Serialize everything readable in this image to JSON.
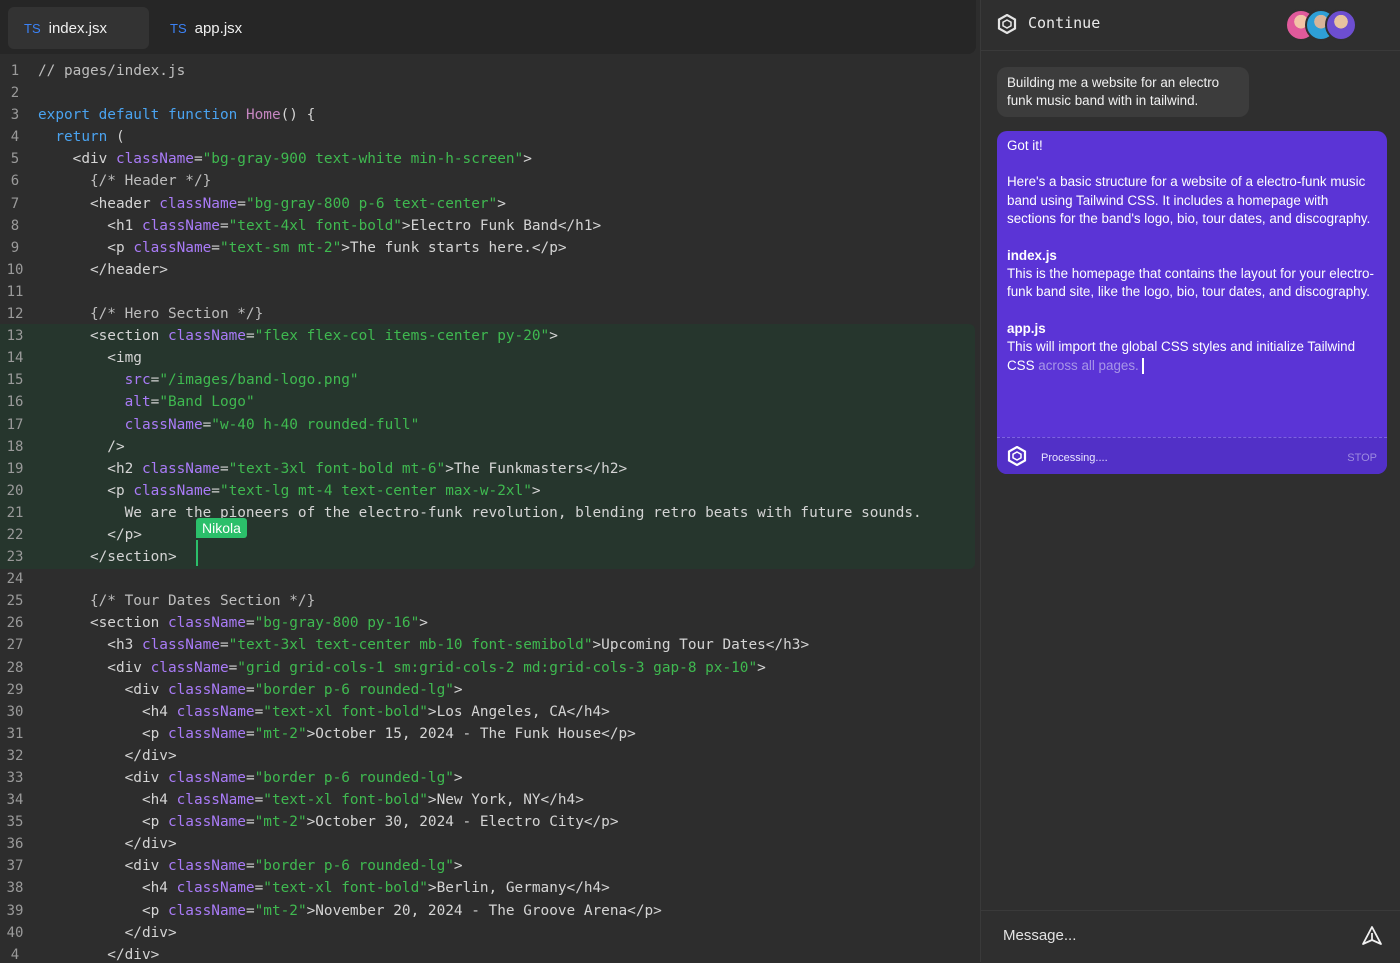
{
  "tabs": [
    {
      "badge": "TS",
      "label": "index.jsx",
      "active": true
    },
    {
      "badge": "TS",
      "label": "app.jsx",
      "active": false
    }
  ],
  "code_lines": [
    {
      "n": "1",
      "html": "<span class=\"c\">// pages/index.js</span>"
    },
    {
      "n": "2",
      "html": ""
    },
    {
      "n": "3",
      "html": "<span class=\"k\">export default function</span> <span class=\"fn\">Home</span>() {"
    },
    {
      "n": "4",
      "html": "  <span class=\"k\">return</span> ("
    },
    {
      "n": "5",
      "html": "    &lt;div <span class=\"a\">className</span>=<span class=\"s\">\"bg-gray-900 text-white min-h-screen\"</span>&gt;"
    },
    {
      "n": "6",
      "html": "      <span class=\"c\">{/* Header */}</span>"
    },
    {
      "n": "7",
      "html": "      &lt;header <span class=\"a\">className</span>=<span class=\"s\">\"bg-gray-800 p-6 text-center\"</span>&gt;"
    },
    {
      "n": "8",
      "html": "        &lt;h1 <span class=\"a\">className</span>=<span class=\"s\">\"text-4xl font-bold\"</span>&gt;Electro Funk Band&lt;/h1&gt;"
    },
    {
      "n": "9",
      "html": "        &lt;p <span class=\"a\">className</span>=<span class=\"s\">\"text-sm mt-2\"</span>&gt;The funk starts here.&lt;/p&gt;"
    },
    {
      "n": "10",
      "html": "      &lt;/header&gt;"
    },
    {
      "n": "11",
      "html": ""
    },
    {
      "n": "12",
      "html": "      <span class=\"c\">{/* Hero Section */}</span>"
    },
    {
      "n": "13",
      "html": "      &lt;section <span class=\"a\">className</span>=<span class=\"s\">\"flex flex-col items-center py-20\"</span>&gt;"
    },
    {
      "n": "14",
      "html": "        &lt;img"
    },
    {
      "n": "15",
      "html": "          <span class=\"a\">src</span>=<span class=\"s\">\"/images/band-logo.png\"</span>"
    },
    {
      "n": "16",
      "html": "          <span class=\"a\">alt</span>=<span class=\"s\">\"Band Logo\"</span>"
    },
    {
      "n": "17",
      "html": "          <span class=\"a\">className</span>=<span class=\"s\">\"w-40 h-40 rounded-full\"</span>"
    },
    {
      "n": "18",
      "html": "        /&gt;"
    },
    {
      "n": "19",
      "html": "        &lt;h2 <span class=\"a\">className</span>=<span class=\"s\">\"text-3xl font-bold mt-6\"</span>&gt;The Funkmasters&lt;/h2&gt;"
    },
    {
      "n": "20",
      "html": "        &lt;p <span class=\"a\">className</span>=<span class=\"s\">\"text-lg mt-4 text-center max-w-2xl\"</span>&gt;"
    },
    {
      "n": "21",
      "html": "          We are the pioneers of the electro-funk revolution, blending retro beats with future sounds."
    },
    {
      "n": "22",
      "html": "        &lt;/p&gt;"
    },
    {
      "n": "23",
      "html": "      &lt;/section&gt;"
    },
    {
      "n": "24",
      "html": ""
    },
    {
      "n": "25",
      "html": "      <span class=\"c\">{/* Tour Dates Section */}</span>"
    },
    {
      "n": "26",
      "html": "      &lt;section <span class=\"a\">className</span>=<span class=\"s\">\"bg-gray-800 py-16\"</span>&gt;"
    },
    {
      "n": "27",
      "html": "        &lt;h3 <span class=\"a\">className</span>=<span class=\"s\">\"text-3xl text-center mb-10 font-semibold\"</span>&gt;Upcoming Tour Dates&lt;/h3&gt;"
    },
    {
      "n": "28",
      "html": "        &lt;div <span class=\"a\">className</span>=<span class=\"s\">\"grid grid-cols-1 sm:grid-cols-2 md:grid-cols-3 gap-8 px-10\"</span>&gt;"
    },
    {
      "n": "29",
      "html": "          &lt;div <span class=\"a\">className</span>=<span class=\"s\">\"border p-6 rounded-lg\"</span>&gt;"
    },
    {
      "n": "30",
      "html": "            &lt;h4 <span class=\"a\">className</span>=<span class=\"s\">\"text-xl font-bold\"</span>&gt;Los Angeles, CA&lt;/h4&gt;"
    },
    {
      "n": "31",
      "html": "            &lt;p <span class=\"a\">className</span>=<span class=\"s\">\"mt-2\"</span>&gt;October 15, 2024 - The Funk House&lt;/p&gt;"
    },
    {
      "n": "32",
      "html": "          &lt;/div&gt;"
    },
    {
      "n": "33",
      "html": "          &lt;div <span class=\"a\">className</span>=<span class=\"s\">\"border p-6 rounded-lg\"</span>&gt;"
    },
    {
      "n": "34",
      "html": "            &lt;h4 <span class=\"a\">className</span>=<span class=\"s\">\"text-xl font-bold\"</span>&gt;New York, NY&lt;/h4&gt;"
    },
    {
      "n": "35",
      "html": "            &lt;p <span class=\"a\">className</span>=<span class=\"s\">\"mt-2\"</span>&gt;October 30, 2024 - Electro City&lt;/p&gt;"
    },
    {
      "n": "36",
      "html": "          &lt;/div&gt;"
    },
    {
      "n": "37",
      "html": "          &lt;div <span class=\"a\">className</span>=<span class=\"s\">\"border p-6 rounded-lg\"</span>&gt;"
    },
    {
      "n": "38",
      "html": "            &lt;h4 <span class=\"a\">className</span>=<span class=\"s\">\"text-xl font-bold\"</span>&gt;Berlin, Germany&lt;/h4&gt;"
    },
    {
      "n": "39",
      "html": "            &lt;p <span class=\"a\">className</span>=<span class=\"s\">\"mt-2\"</span>&gt;November 20, 2024 - The Groove Arena&lt;/p&gt;"
    },
    {
      "n": "40",
      "html": "          &lt;/div&gt;"
    },
    {
      "n": "4",
      "html": "        &lt;/div&gt;"
    }
  ],
  "collaborator": {
    "name": "Nikola",
    "color": "#2bbf6a"
  },
  "chat": {
    "title": "Continue",
    "user_message": "Building me a website for an electro funk music band with in tailwind.",
    "ai_message": {
      "intro": "Got it!",
      "para1": "Here's a basic structure for a website of a electro-funk music band using Tailwind CSS. It includes a homepage with sections for the band's logo, bio, tour dates, and discography.",
      "file1_name": "index.js",
      "file1_desc": "This is the homepage that contains the layout for your electro-funk band site, like the logo, bio, tour dates, and discography.",
      "file2_name": "app.js",
      "file2_desc": "This will import the global CSS styles and initialize Tailwind CSS",
      "file2_desc_streaming": "across all pages."
    },
    "status": "Processing....",
    "stop_label": "STOP",
    "input_placeholder": "Message..."
  },
  "colors": {
    "accent_purple": "#5b34d6",
    "string_green": "#3fb950",
    "keyword_blue": "#4aa3f0",
    "attr_purple": "#a97bf7",
    "collab_green": "#2bbf6a"
  },
  "icons": [
    "continue-logo-icon",
    "avatar-group",
    "processing-spinner-icon",
    "send-icon"
  ]
}
